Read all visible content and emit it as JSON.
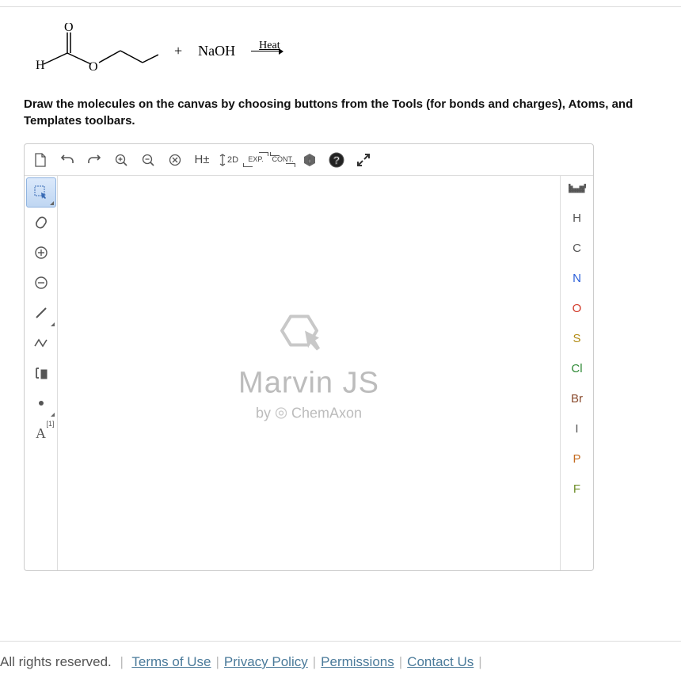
{
  "reaction": {
    "plus": "+",
    "reagent": "NaOH",
    "condition": "Heat"
  },
  "instructions": "Draw the molecules on the canvas by choosing buttons from the Tools (for bonds and charges), Atoms, and Templates toolbars.",
  "topToolbar": {
    "hbtn": "H±",
    "dim": "2D",
    "exp": "EXP.",
    "cont": "CONT."
  },
  "leftToolbar": {
    "mapLabel": "[1]",
    "mapA": "A"
  },
  "watermark": {
    "title": "Marvin JS",
    "byPrefix": "by",
    "company": "ChemAxon"
  },
  "atoms": [
    {
      "label": "H",
      "color": "#555"
    },
    {
      "label": "C",
      "color": "#555"
    },
    {
      "label": "N",
      "color": "#2b5fd9"
    },
    {
      "label": "O",
      "color": "#d23b2a"
    },
    {
      "label": "S",
      "color": "#b28b14"
    },
    {
      "label": "Cl",
      "color": "#2f8a36"
    },
    {
      "label": "Br",
      "color": "#8a4b2e"
    },
    {
      "label": "I",
      "color": "#555"
    },
    {
      "label": "P",
      "color": "#c46a1e"
    },
    {
      "label": "F",
      "color": "#6e8e2a"
    }
  ],
  "footer": {
    "rights": "All rights reserved.",
    "links": [
      "Terms of Use",
      "Privacy Policy",
      "Permissions",
      "Contact Us"
    ]
  }
}
